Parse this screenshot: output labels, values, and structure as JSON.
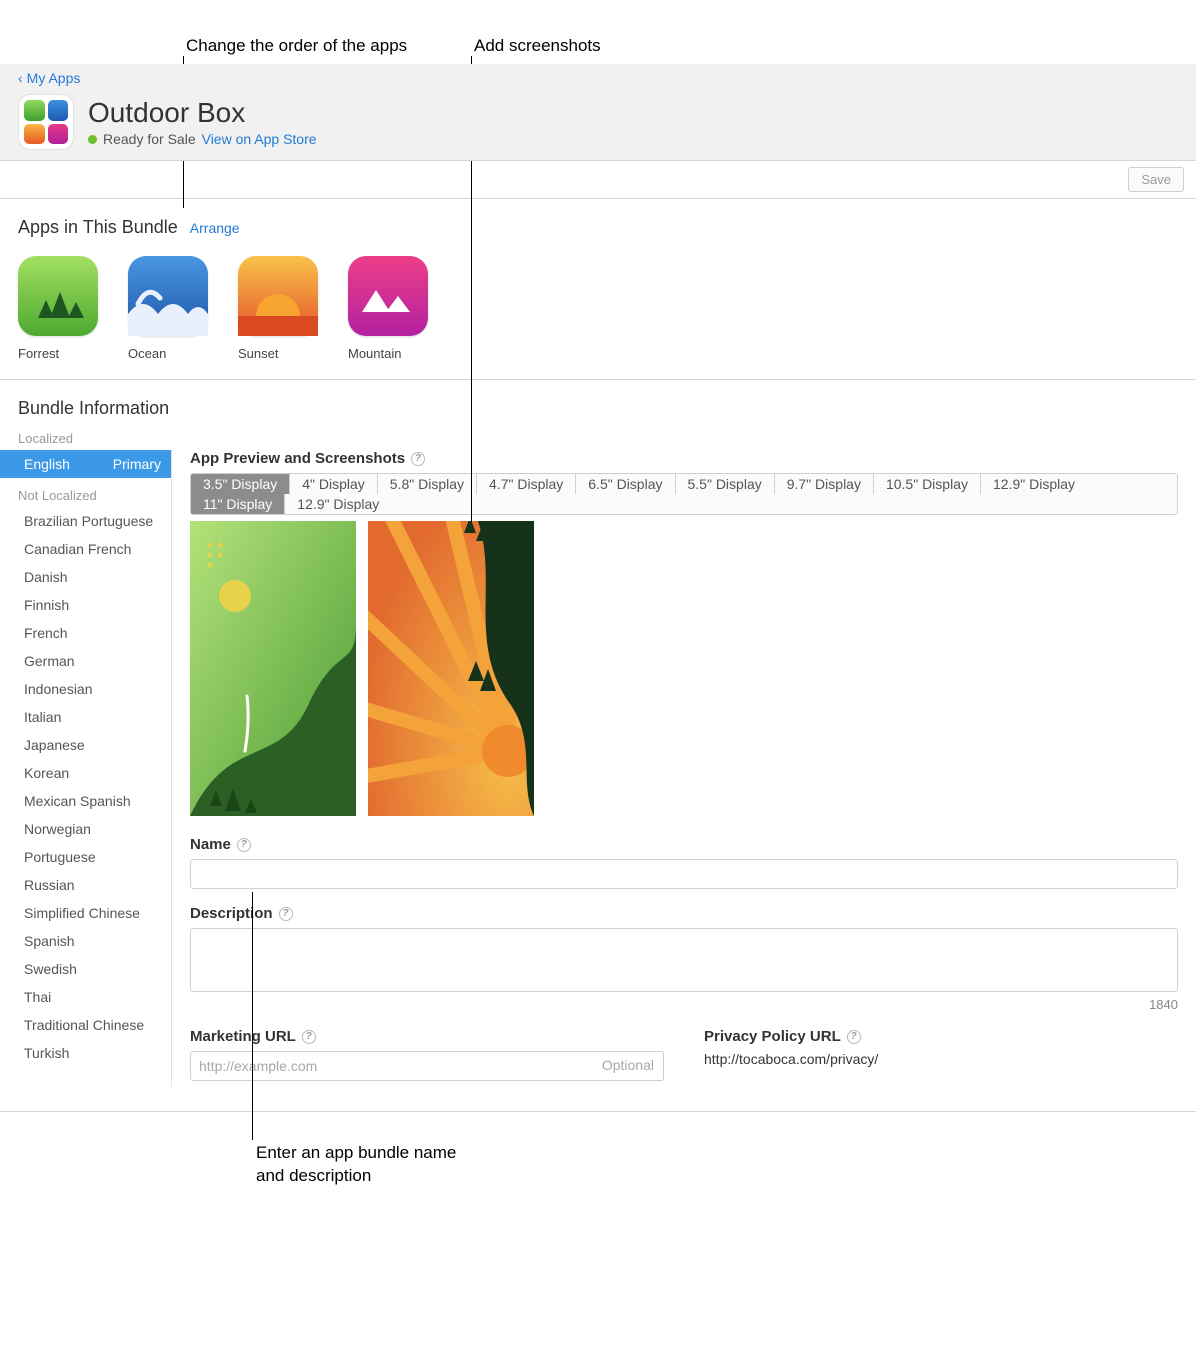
{
  "annotations": {
    "reorder": "Change the order of the apps",
    "addshots": "Add screenshots",
    "bottom_l1": "Enter an app bundle name",
    "bottom_l2": "and description"
  },
  "header": {
    "back_label": "My Apps",
    "title": "Outdoor Box",
    "status": "Ready for Sale",
    "view_link": "View on App Store"
  },
  "savebar": {
    "save": "Save"
  },
  "apps_section": {
    "title": "Apps in This Bundle",
    "arrange": "Arrange",
    "apps": [
      {
        "name": "Forrest"
      },
      {
        "name": "Ocean"
      },
      {
        "name": "Sunset"
      },
      {
        "name": "Mountain"
      }
    ]
  },
  "bundle_info": {
    "title": "Bundle Information",
    "localized_hdr": "Localized",
    "not_localized_hdr": "Not Localized",
    "selected_lang": "English",
    "selected_badge": "Primary",
    "langs": [
      "Brazilian Portuguese",
      "Canadian French",
      "Danish",
      "Finnish",
      "French",
      "German",
      "Indonesian",
      "Italian",
      "Japanese",
      "Korean",
      "Mexican Spanish",
      "Norwegian",
      "Portuguese",
      "Russian",
      "Simplified Chinese",
      "Spanish",
      "Swedish",
      "Thai",
      "Traditional Chinese",
      "Turkish"
    ],
    "preview_label": "App Preview and Screenshots",
    "display_sizes_row1": [
      "3.5\" Display",
      "4\" Display",
      "5.8\" Display",
      "4.7\" Display",
      "6.5\" Display",
      "5.5\" Display",
      "9.7\" Display",
      "10.5\" Display",
      "12.9\" Display"
    ],
    "display_sizes_row2": [
      "11\" Display",
      "12.9\" Display"
    ],
    "selected_size_row1": "3.5\" Display",
    "selected_size_row2": "11\" Display",
    "name_label": "Name",
    "name_value": "",
    "desc_label": "Description",
    "desc_value": "",
    "desc_counter": "1840",
    "marketing_label": "Marketing URL",
    "marketing_placeholder": "http://example.com",
    "marketing_optional": "Optional",
    "privacy_label": "Privacy Policy URL",
    "privacy_value": "http://tocaboca.com/privacy/"
  }
}
